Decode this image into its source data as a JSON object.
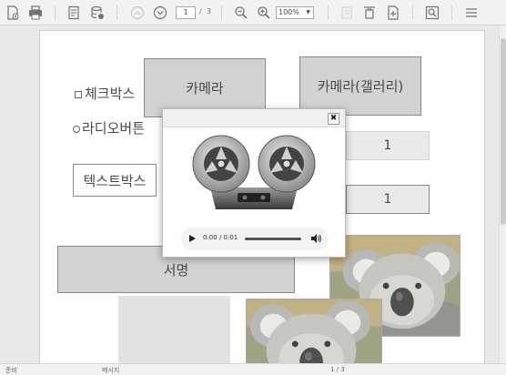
{
  "toolbar": {
    "page_current": "1",
    "page_separator": "/",
    "page_total": "3",
    "zoom": "100%"
  },
  "document": {
    "checkbox_label": "체크박스",
    "radio_label": "라디오버튼",
    "textbox_label": "텍스트박스",
    "camera_button": "카메라",
    "camera_gallery_button": "카메라(갤러리)",
    "field_1_value": "1",
    "field_2_value": "1",
    "signature_button": "서명"
  },
  "audio": {
    "time": "0:00 / 0:01"
  },
  "status": {
    "ready": "준비",
    "message": "메시지",
    "page_indicator": "1 / 3"
  },
  "colors": {
    "toolbar_bg": "#f0f0f0",
    "doc_bg": "#e3e3e3",
    "button_gray": "#c8c8c8"
  }
}
